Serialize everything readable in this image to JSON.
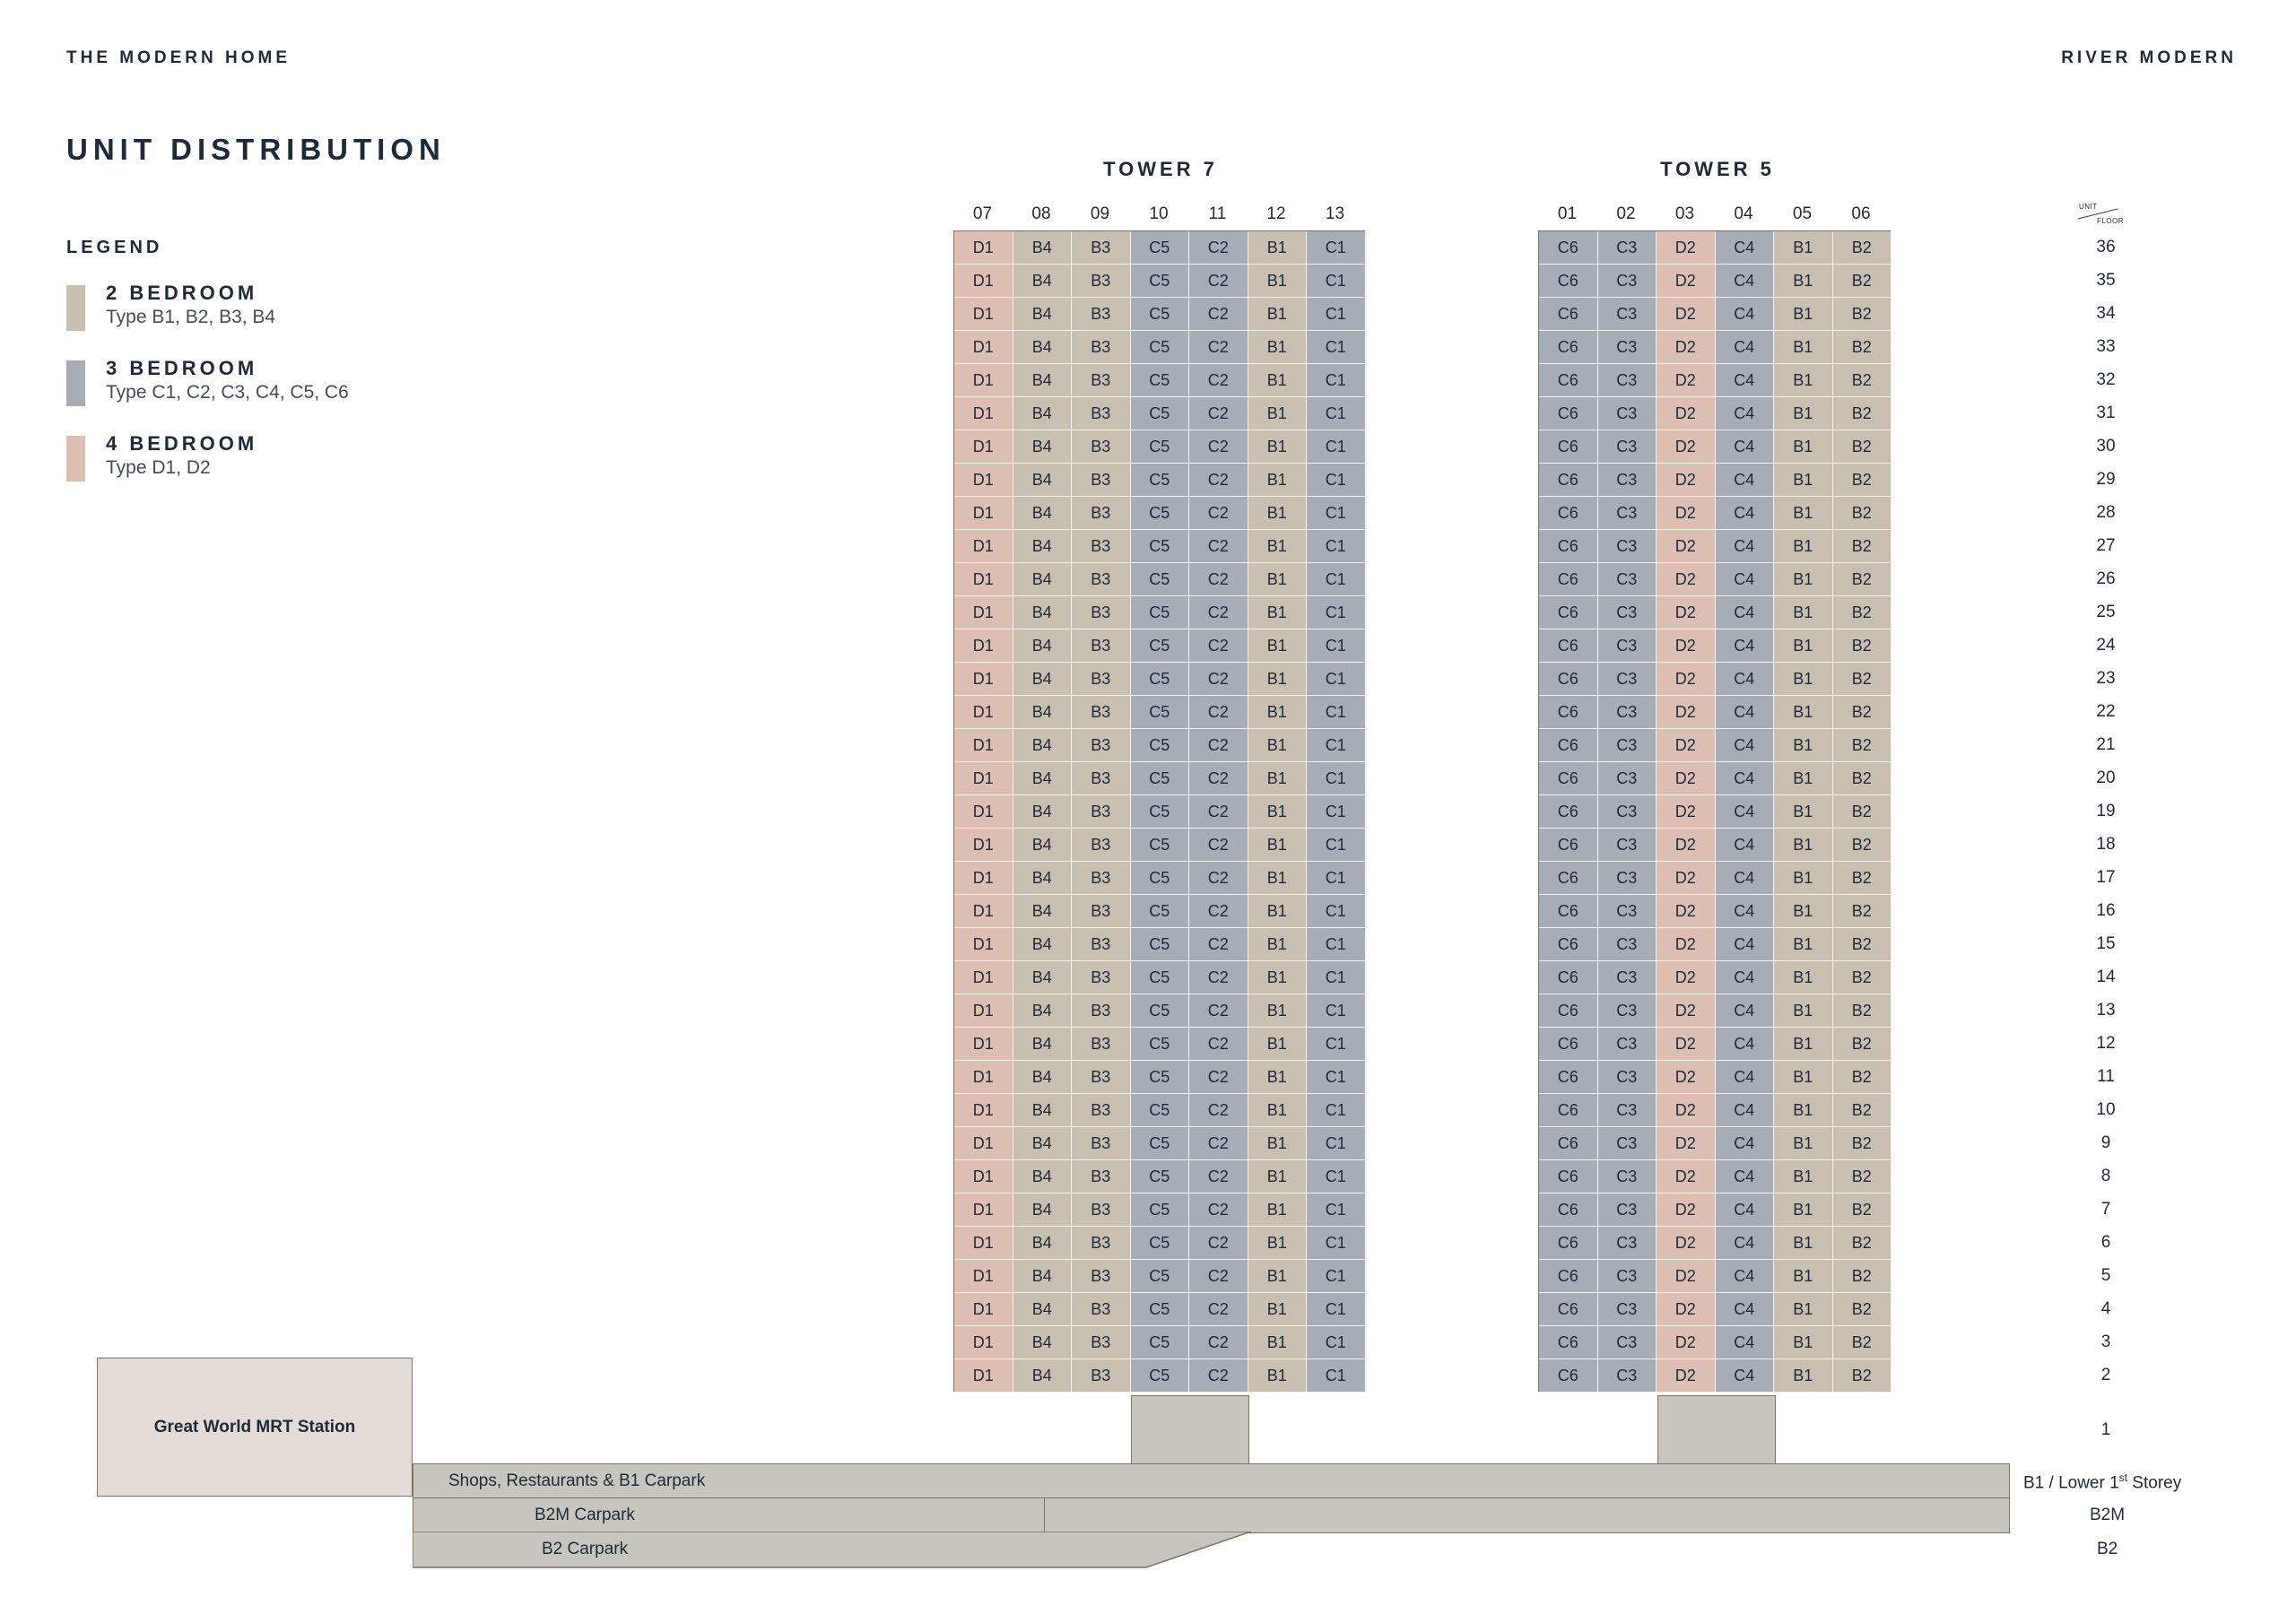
{
  "header": {
    "left": "THE MODERN HOME",
    "right": "RIVER MODERN"
  },
  "title": "UNIT DISTRIBUTION",
  "legend": {
    "title": "LEGEND",
    "items": [
      {
        "name": "2 BEDROOM",
        "types": "Type B1, B2, B3, B4",
        "color": "#c8bfb1"
      },
      {
        "name": "3 BEDROOM",
        "types": "Type C1, C2, C3, C4, C5, C6",
        "color": "#a6adb6"
      },
      {
        "name": "4 BEDROOM",
        "types": "Type D1, D2",
        "color": "#ddbeb2"
      }
    ]
  },
  "axis": {
    "unit_label": "UNIT",
    "floor_label": "FLOOR"
  },
  "floors": [
    "36",
    "35",
    "34",
    "33",
    "32",
    "31",
    "30",
    "29",
    "28",
    "27",
    "26",
    "25",
    "24",
    "23",
    "22",
    "21",
    "20",
    "19",
    "18",
    "17",
    "16",
    "15",
    "14",
    "13",
    "12",
    "11",
    "10",
    "9",
    "8",
    "7",
    "6",
    "5",
    "4",
    "3",
    "2"
  ],
  "floor_1": "1",
  "towers": [
    {
      "name": "TOWER 7",
      "columns": [
        "07",
        "08",
        "09",
        "10",
        "11",
        "12",
        "13"
      ],
      "unit_types": [
        "D1",
        "B4",
        "B3",
        "C5",
        "C2",
        "B1",
        "C1"
      ]
    },
    {
      "name": "TOWER 5",
      "columns": [
        "01",
        "02",
        "03",
        "04",
        "05",
        "06"
      ],
      "unit_types": [
        "C6",
        "C3",
        "D2",
        "C4",
        "B1",
        "B2"
      ]
    }
  ],
  "podium": {
    "mrt": "Great World MRT Station",
    "shops": "Shops, Restaurants & B1 Carpark",
    "b2m": "B2M Carpark",
    "b2": "B2 Carpark"
  },
  "levels": {
    "b1_prefix": "B1 / Lower 1",
    "b1_sup": "st",
    "b1_suffix": " Storey",
    "b2m": "B2M",
    "b2": "B2"
  },
  "colors": {
    "B": "#c8bfb1",
    "C": "#a6adb6",
    "D": "#ddbeb2",
    "podium": "#c6c6bf",
    "mrt": "#e3dcd6",
    "outline": "#7d7467"
  }
}
